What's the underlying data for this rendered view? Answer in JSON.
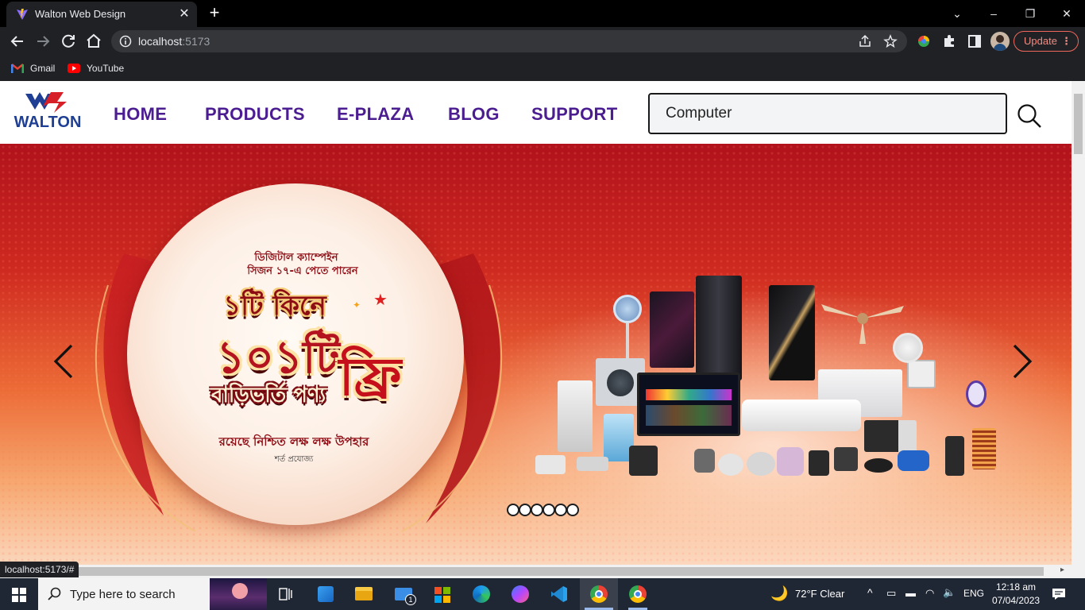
{
  "browser": {
    "tab_title": "Walton Web Design",
    "url_host": "localhost",
    "url_port": ":5173",
    "update_label": "Update",
    "bookmarks": [
      {
        "label": "Gmail",
        "icon": "gmail-icon"
      },
      {
        "label": "YouTube",
        "icon": "youtube-icon"
      }
    ],
    "status_url": "localhost:5173/#"
  },
  "site": {
    "logo_text": "WALTON",
    "nav": [
      {
        "label": "HOME"
      },
      {
        "label": "PRODUCTS"
      },
      {
        "label": "E-PLAZA"
      },
      {
        "label": "BLOG"
      },
      {
        "label": "SUPPORT"
      }
    ],
    "search_value": "Computer"
  },
  "banner": {
    "subtitle_line1": "ডিজিটাল ক্যাম্পেইন",
    "subtitle_line2": "সিজন ১৭-এ পেতে পারেন",
    "headline_1": "১টি কিনে",
    "headline_2": "১০১টি",
    "headline_3": "বাড়িভর্তি পণ্য",
    "free_badge": "ফ্রি",
    "tagline": "রয়েছে নিশ্চিত লক্ষ লক্ষ উপহার",
    "terms": "শর্ত প্রযোজ্য",
    "slide_count": 6,
    "active_slide": 1
  },
  "taskbar": {
    "search_placeholder": "Type here to search",
    "weather": "72°F  Clear",
    "language": "ENG",
    "time": "12:18 am",
    "date": "07/04/2023",
    "mail_badge": "1"
  },
  "colors": {
    "nav_purple": "#4b1d91",
    "walton_blue": "#1f3f94",
    "walton_red": "#d71f27",
    "banner_red": "#c21a1f"
  }
}
